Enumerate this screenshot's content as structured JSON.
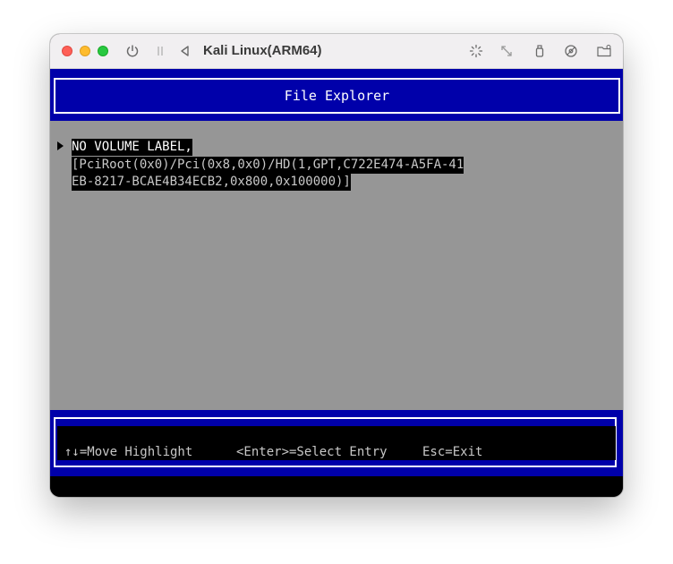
{
  "window": {
    "title": "Kali Linux(ARM64)",
    "icons": [
      "power-icon",
      "pause-icon",
      "back-triangle-icon",
      "brightness-icon",
      "resize-icon",
      "usb-icon",
      "disc-icon",
      "folder-icon"
    ]
  },
  "firmware": {
    "header_title": "File Explorer",
    "entry": {
      "line1": "NO VOLUME LABEL,",
      "line2": "[PciRoot(0x0)/Pci(0x8,0x0)/HD(1,GPT,C722E474-A5FA-41",
      "line3": "EB-8217-BCAE4B34ECB2,0x800,0x100000)]"
    },
    "help": {
      "move": "↑↓=Move Highlight",
      "select": "<Enter>=Select Entry",
      "exit": "Esc=Exit"
    }
  },
  "colors": {
    "bios_blue": "#0000aa",
    "content_gray": "#969696",
    "text_white": "#ffffff"
  }
}
